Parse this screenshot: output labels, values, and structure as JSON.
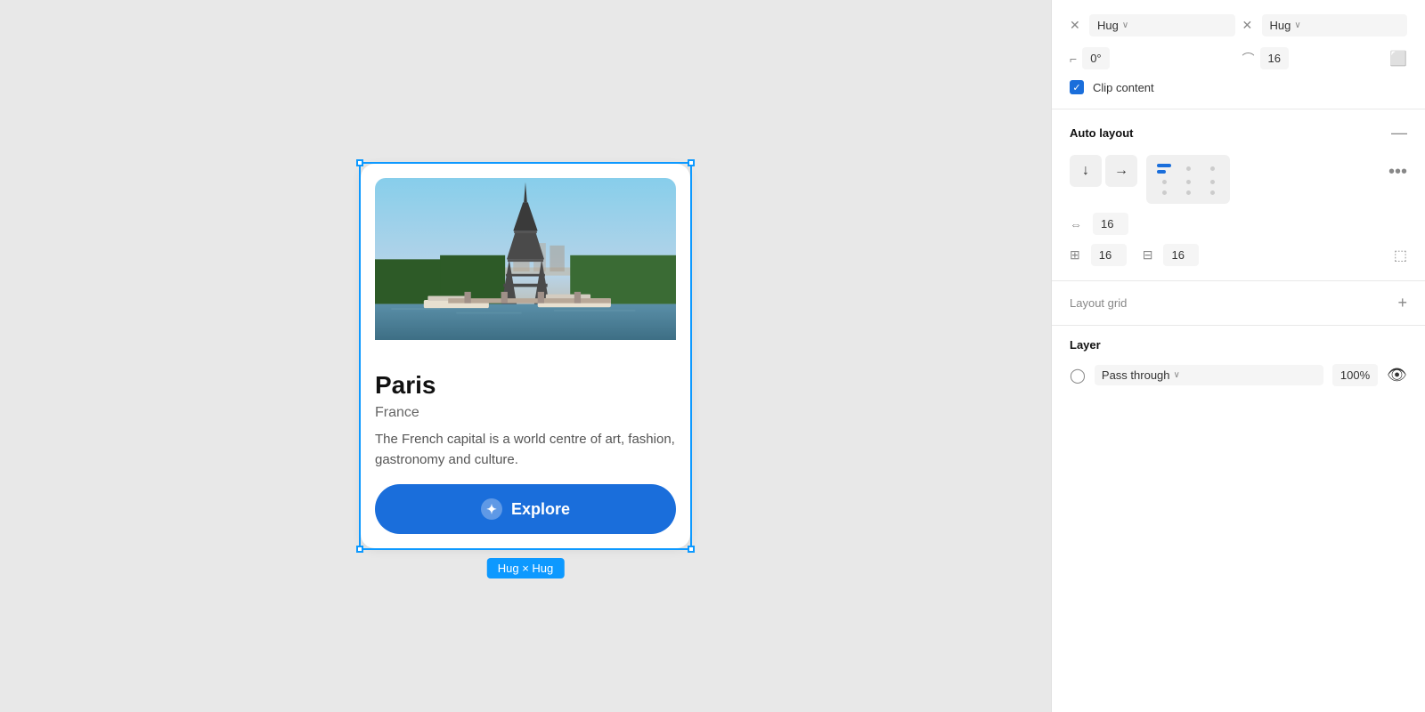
{
  "canvas": {
    "background": "#e8e8e8"
  },
  "card": {
    "city": "Paris",
    "country": "France",
    "description": "The French capital is a world centre of art, fashion, gastronomy and culture.",
    "button_label": "Explore",
    "hug_label": "Hug × Hug"
  },
  "panel": {
    "width_label": "Hug",
    "height_label": "Hug",
    "rotation": "0°",
    "corner_radius": "16",
    "clip_content_label": "Clip content",
    "auto_layout_title": "Auto layout",
    "auto_layout_remove": "—",
    "gap_value": "16",
    "padding_h": "16",
    "padding_v": "16",
    "layout_grid_title": "Layout grid",
    "layout_grid_add": "+",
    "layer_title": "Layer",
    "blend_mode": "Pass through",
    "opacity": "100%"
  },
  "icons": {
    "down_arrow": "↓",
    "right_arrow": "→",
    "more": "•••",
    "add": "+",
    "minus": "—",
    "eye": "👁",
    "compass": "✦",
    "check": "✓"
  }
}
